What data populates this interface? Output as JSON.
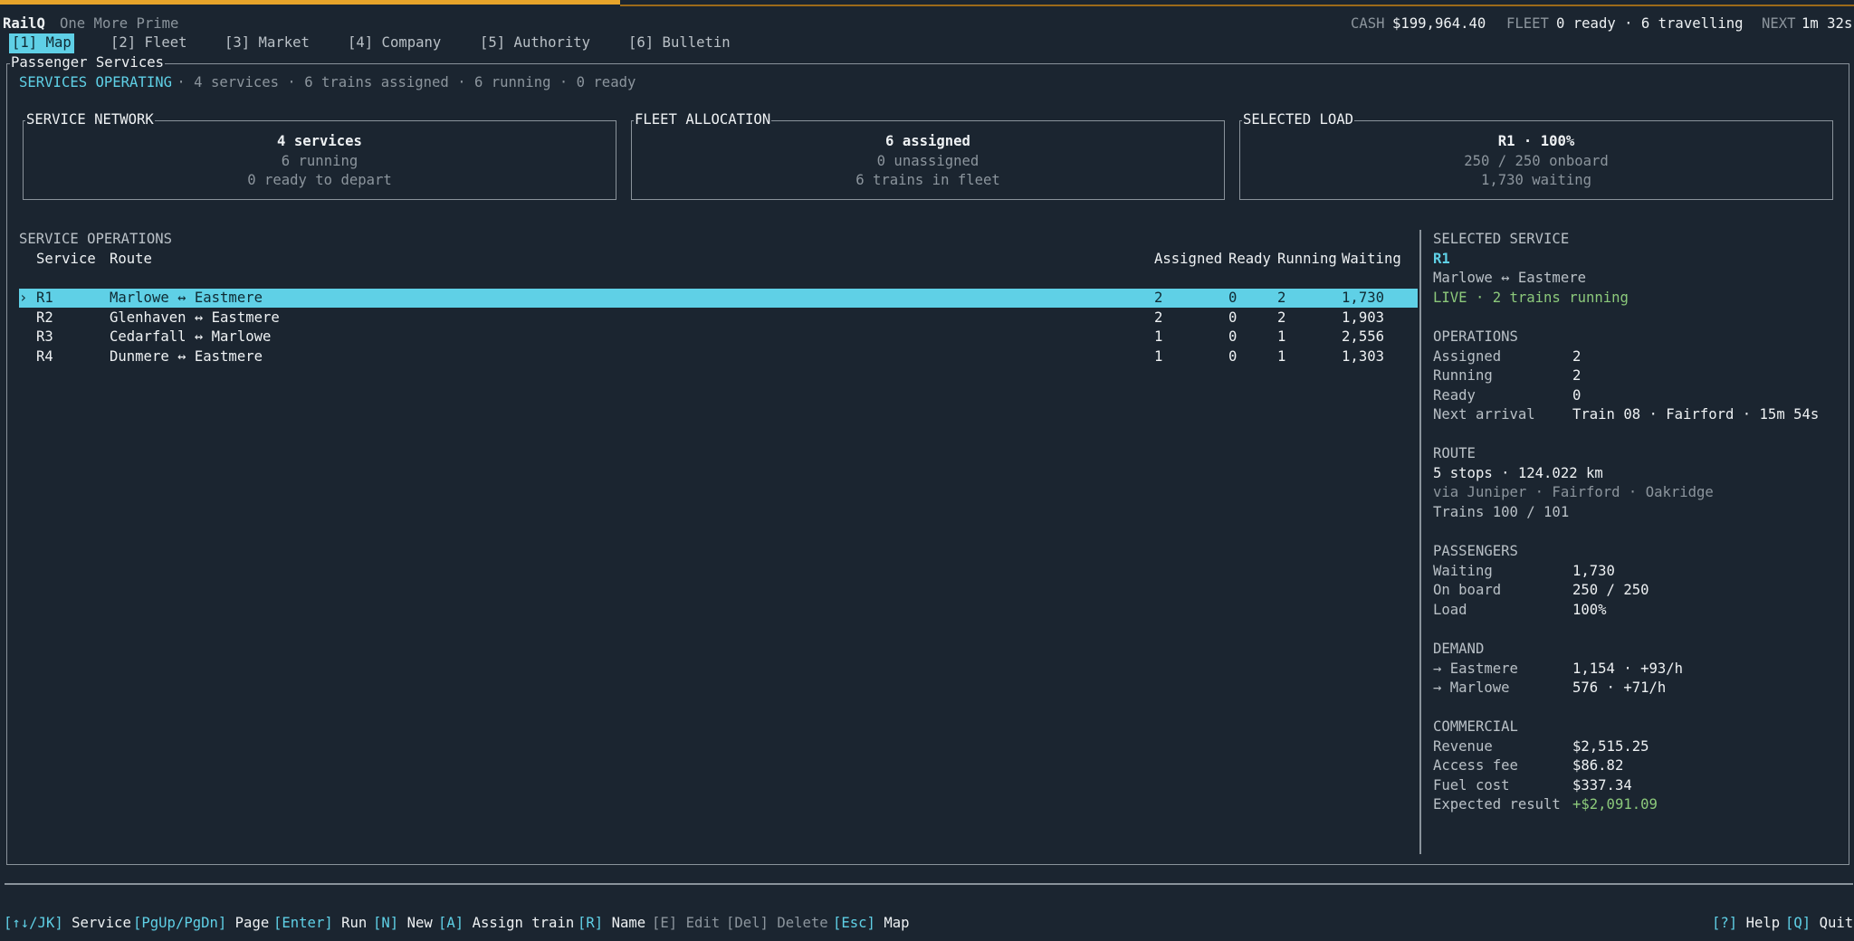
{
  "app": {
    "name": "RailQ",
    "subtitle": "One More Prime"
  },
  "status": {
    "cash_label": "CASH",
    "cash_value": "$199,964.40",
    "fleet_label": "FLEET",
    "fleet_value": "0 ready · 6 travelling",
    "next_label": "NEXT",
    "next_value": "1m 32s"
  },
  "tabs": [
    "[1] Map",
    "[2] Fleet",
    "[3] Market",
    "[4] Company",
    "[5] Authority",
    "[6] Bulletin"
  ],
  "panel": {
    "title": "Passenger Services",
    "summary_label": "SERVICES OPERATING",
    "summary_rest": " · 4 services · 6 trains assigned · 6 running · 0 ready"
  },
  "cards": {
    "network": {
      "title": "SERVICE NETWORK",
      "l1": "4 services",
      "l2": "6 running",
      "l3": "0 ready to depart"
    },
    "fleet": {
      "title": "FLEET ALLOCATION",
      "l1": "6 assigned",
      "l2": "0 unassigned",
      "l3": "6 trains in fleet"
    },
    "load": {
      "title": "SELECTED LOAD",
      "l1": "R1 · 100%",
      "l2": "250 / 250 onboard",
      "l3": "1,730 waiting"
    }
  },
  "operations": {
    "title": "SERVICE OPERATIONS",
    "headers": {
      "service": "Service",
      "route": "Route",
      "assigned": "Assigned",
      "ready": "Ready",
      "running": "Running",
      "waiting": "Waiting"
    },
    "selector": "›",
    "rows": [
      {
        "service": "R1",
        "route": "Marlowe ↔ Eastmere",
        "assigned": "2",
        "ready": "0",
        "running": "2",
        "waiting": "1,730"
      },
      {
        "service": "R2",
        "route": "Glenhaven ↔ Eastmere",
        "assigned": "2",
        "ready": "0",
        "running": "2",
        "waiting": "1,903"
      },
      {
        "service": "R3",
        "route": "Cedarfall ↔ Marlowe",
        "assigned": "1",
        "ready": "0",
        "running": "1",
        "waiting": "2,556"
      },
      {
        "service": "R4",
        "route": "Dunmere ↔ Eastmere",
        "assigned": "1",
        "ready": "0",
        "running": "1",
        "waiting": "1,303"
      }
    ]
  },
  "details": {
    "title": "SELECTED SERVICE",
    "service_id": "R1",
    "route": "Marlowe ↔ Eastmere",
    "live": "LIVE · 2 trains running",
    "operations_title": "OPERATIONS",
    "assigned_label": "Assigned",
    "assigned_value": "2",
    "running_label": "Running",
    "running_value": "2",
    "ready_label": "Ready",
    "ready_value": "0",
    "next_arrival_label": "Next arrival",
    "next_arrival_value": "Train 08 · Fairford · 15m 54s",
    "route_title": "ROUTE",
    "route_l1": "5 stops · 124.022 km",
    "route_l2": "via Juniper · Fairford · Oakridge",
    "route_l3": "Trains 100 / 101",
    "passengers_title": "PASSENGERS",
    "waiting_label": "Waiting",
    "waiting_value": "1,730",
    "onboard_label": "On board",
    "onboard_value": "250 / 250",
    "load_label": "Load",
    "load_value": "100%",
    "demand_title": "DEMAND",
    "demand1_label": "→ Eastmere",
    "demand1_value": "1,154 · +93/h",
    "demand2_label": "→ Marlowe",
    "demand2_value": "576 · +71/h",
    "commercial_title": "COMMERCIAL",
    "revenue_label": "Revenue",
    "revenue_value": "$2,515.25",
    "access_label": "Access fee",
    "access_value": "$86.82",
    "fuel_label": "Fuel cost",
    "fuel_value": "$337.34",
    "expected_label": "Expected result",
    "expected_value": "+$2,091.09"
  },
  "footer": {
    "k_service": "[↑↓/JK]",
    "t_service": "Service",
    "k_page": "[PgUp/PgDn]",
    "t_page": "Page",
    "k_run": "[Enter]",
    "t_run": "Run",
    "k_new": "[N]",
    "t_new": "New",
    "k_assign": "[A]",
    "t_assign": "Assign train",
    "k_name": "[R]",
    "t_name": "Name",
    "k_edit": "[E]",
    "t_edit": "Edit",
    "k_delete": "[Del]",
    "t_delete": "Delete",
    "k_map": "[Esc]",
    "t_map": "Map",
    "k_help": "[?]",
    "t_help": "Help",
    "k_quit": "[Q]",
    "t_quit": "Quit"
  }
}
